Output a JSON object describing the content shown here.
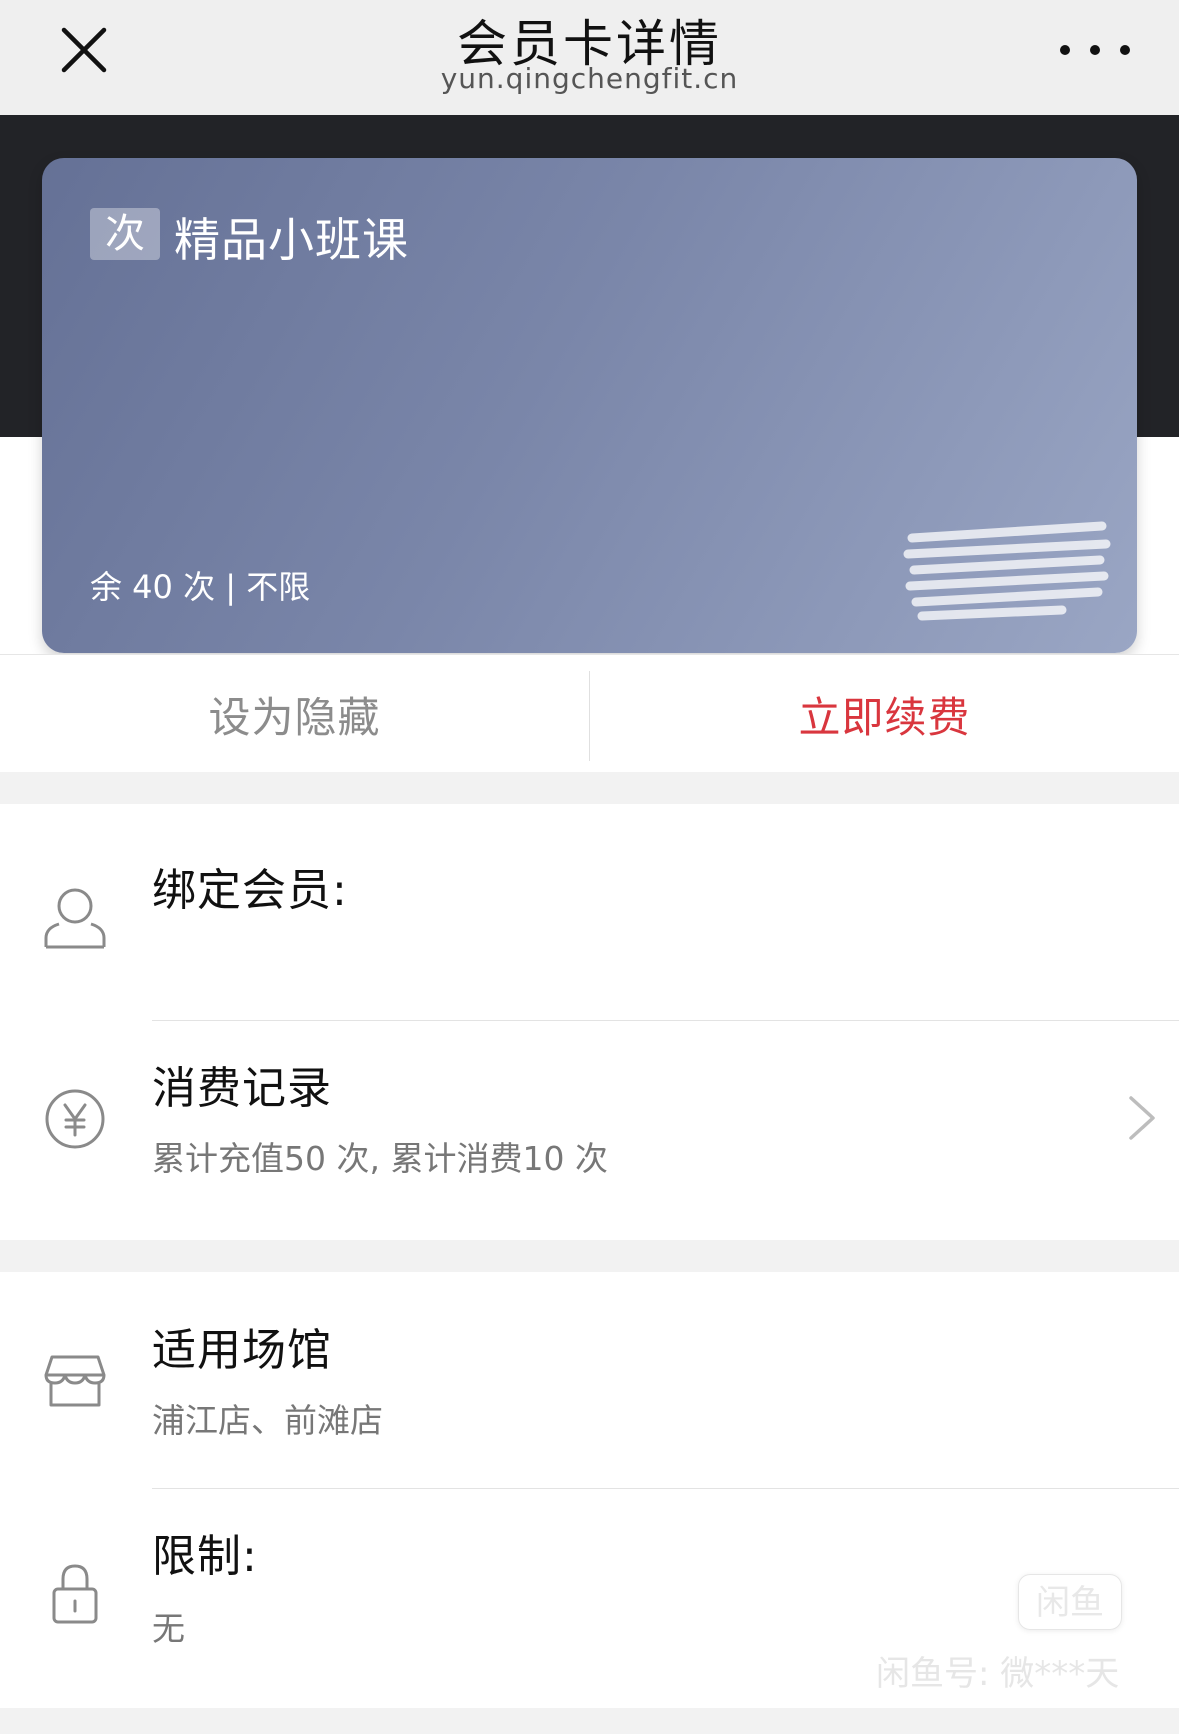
{
  "header": {
    "title": "会员卡详情",
    "url": "yun.qingchengfit.cn"
  },
  "card": {
    "badge": "次",
    "name": "精品小班课",
    "balance": "余 40 次 | 不限"
  },
  "actions": {
    "hide_label": "设为隐藏",
    "renew_label": "立即续费",
    "renew_color": "#d9363e"
  },
  "rows": {
    "member": {
      "title": "绑定会员:",
      "icon": "user-icon"
    },
    "records": {
      "title": "消费记录",
      "subtitle": "累计充值50 次, 累计消费10 次",
      "icon": "yuan-icon"
    },
    "venues": {
      "title": "适用场馆",
      "subtitle": "浦江店、前滩店",
      "icon": "store-icon"
    },
    "limit": {
      "title": "限制:",
      "subtitle": "无",
      "icon": "lock-icon"
    }
  },
  "watermark": {
    "logo": "闲鱼",
    "text": "闲鱼号: 微***天"
  }
}
